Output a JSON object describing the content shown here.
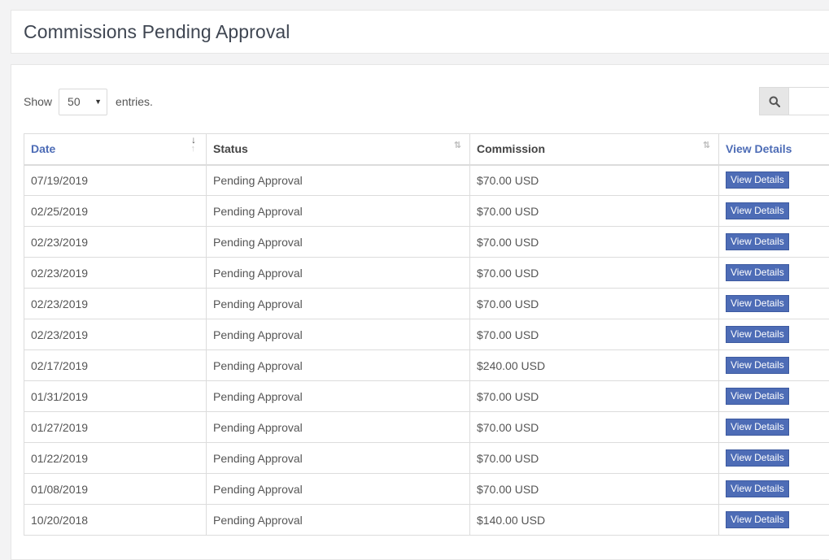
{
  "page": {
    "title": "Commissions Pending Approval"
  },
  "controls": {
    "show_label": "Show",
    "entries_value": "50",
    "entries_label": "entries."
  },
  "table": {
    "columns": [
      "Date",
      "Status",
      "Commission",
      "View Details"
    ],
    "button_label": "View Details",
    "rows": [
      {
        "date": "07/19/2019",
        "status": "Pending Approval",
        "commission": "$70.00 USD"
      },
      {
        "date": "02/25/2019",
        "status": "Pending Approval",
        "commission": "$70.00 USD"
      },
      {
        "date": "02/23/2019",
        "status": "Pending Approval",
        "commission": "$70.00 USD"
      },
      {
        "date": "02/23/2019",
        "status": "Pending Approval",
        "commission": "$70.00 USD"
      },
      {
        "date": "02/23/2019",
        "status": "Pending Approval",
        "commission": "$70.00 USD"
      },
      {
        "date": "02/23/2019",
        "status": "Pending Approval",
        "commission": "$70.00 USD"
      },
      {
        "date": "02/17/2019",
        "status": "Pending Approval",
        "commission": "$240.00 USD"
      },
      {
        "date": "01/31/2019",
        "status": "Pending Approval",
        "commission": "$70.00 USD"
      },
      {
        "date": "01/27/2019",
        "status": "Pending Approval",
        "commission": "$70.00 USD"
      },
      {
        "date": "01/22/2019",
        "status": "Pending Approval",
        "commission": "$70.00 USD"
      },
      {
        "date": "01/08/2019",
        "status": "Pending Approval",
        "commission": "$70.00 USD"
      },
      {
        "date": "10/20/2018",
        "status": "Pending Approval",
        "commission": "$140.00 USD"
      }
    ]
  },
  "icons": {
    "search": "search-icon",
    "sort": "sort-icon",
    "dropdown": "caret-down-icon"
  },
  "colors": {
    "accent": "#4d6cb6",
    "border": "#dcdcdc",
    "background": "#f3f3f4"
  }
}
